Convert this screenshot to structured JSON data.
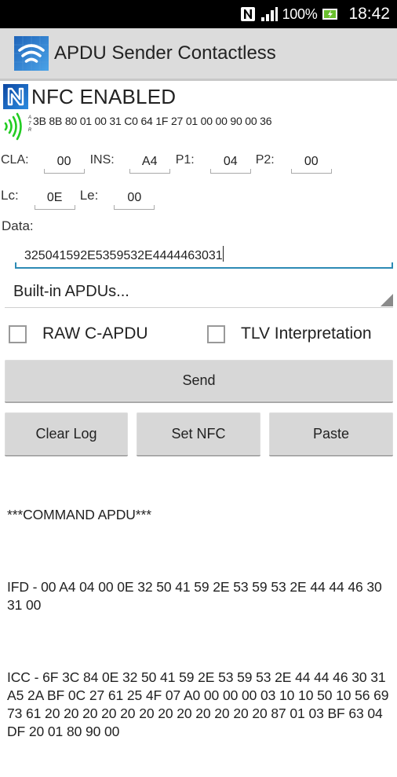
{
  "status_bar": {
    "icons": [
      "nfc-icon",
      "signal-icon",
      "battery-charging-icon"
    ],
    "battery_percent": "100%",
    "time": "18:42",
    "battery_color": "#6abf2e"
  },
  "action_bar": {
    "app_icon": "contactless-wifi-icon",
    "title": "APDU Sender Contactless"
  },
  "nfc": {
    "icon": "nfc-logo-icon",
    "status": "NFC ENABLED",
    "status_icon_color": "#1565c0"
  },
  "atr": {
    "icon": "contactless-waves-icon",
    "icon_color": "#22cc22",
    "label": [
      "A",
      "T",
      "R"
    ],
    "value": "3B 8B 80 01 00 31 C0 64 1F 27 01 00 00 90 00 36"
  },
  "apdu_header": {
    "cla": {
      "label": "CLA:",
      "value": "00"
    },
    "ins": {
      "label": "INS:",
      "value": "A4"
    },
    "p1": {
      "label": "P1:",
      "value": "04"
    },
    "p2": {
      "label": "P2:",
      "value": "00"
    },
    "lc": {
      "label": "Lc:",
      "value": "0E"
    },
    "le": {
      "label": "Le:",
      "value": "00"
    }
  },
  "data": {
    "label": "Data:",
    "value": "325041592E5359532E4444463031",
    "focus_color": "#2d8bb5"
  },
  "builtin_spinner": {
    "selected": "Built-in APDUs..."
  },
  "options": {
    "raw_capdu": {
      "label": "RAW C-APDU",
      "checked": false
    },
    "tlv": {
      "label": "TLV Interpretation",
      "checked": false
    }
  },
  "buttons": {
    "send": "Send",
    "clear_log": "Clear Log",
    "set_nfc": "Set NFC",
    "paste": "Paste"
  },
  "log": {
    "header": "***COMMAND APDU***",
    "ifd": "IFD - 00 A4 04 00 0E 32 50 41 59 2E 53 59 53 2E 44 44 46 30 31 00",
    "icc": "ICC - 6F 3C 84 0E 32 50 41 59 2E 53 59 53 2E 44 44 46 30 31 A5 2A BF 0C 27 61 25 4F 07 A0 00 00 00 03 10 10 50 10 56 69 73 61 20 20 20 20 20 20 20 20 20 20 20 20 87 01 03 BF 63 04 DF 20 01 80 90 00"
  }
}
